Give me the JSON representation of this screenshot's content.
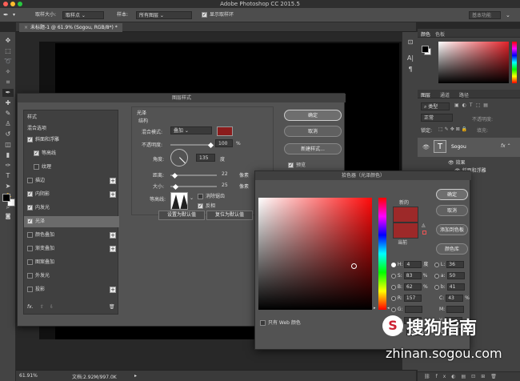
{
  "window": {
    "title": "Adobe Photoshop CC 2015.5"
  },
  "options_bar": {
    "sample_size_label": "取样大小:",
    "sample_size_value": "取样点",
    "sample_label": "样本:",
    "sample_value": "所有图层",
    "show_ring_label": "显示取样环",
    "search_placeholder": "基本功能"
  },
  "document_tab": {
    "label": "未标题-1 @ 61.9% (Sogou, RGB/8*) *"
  },
  "status_bar": {
    "zoom": "61.91%",
    "doc_size": "文档:2.92M/997.0K"
  },
  "right_panel": {
    "color_tabs": [
      "颜色",
      "色板"
    ],
    "layers_tabs": [
      "图层",
      "通道",
      "路径"
    ],
    "kind_label": "类型",
    "blend_mode": "正常",
    "opacity_label": "不透明度:",
    "lock_label": "锁定:",
    "fill_label": "填充:",
    "layer_name": "Sogou",
    "layer_type_glyph": "T",
    "effects_label": "效果",
    "effect_item": "斜面和浮雕"
  },
  "layer_style": {
    "title": "图层样式",
    "style_header": "样式",
    "blend_options": "混合选项",
    "items": [
      {
        "label": "斜面和浮雕",
        "checked": true,
        "plus": false
      },
      {
        "label": "等高线",
        "checked": true,
        "plus": false,
        "sub": true
      },
      {
        "label": "纹理",
        "checked": false,
        "plus": false,
        "sub": true
      },
      {
        "label": "描边",
        "checked": false,
        "plus": true
      },
      {
        "label": "内阴影",
        "checked": true,
        "plus": true
      },
      {
        "label": "内发光",
        "checked": true,
        "plus": false
      },
      {
        "label": "光泽",
        "checked": true,
        "plus": false,
        "selected": true
      },
      {
        "label": "颜色叠加",
        "checked": false,
        "plus": true
      },
      {
        "label": "渐变叠加",
        "checked": false,
        "plus": true
      },
      {
        "label": "图案叠加",
        "checked": false,
        "plus": false
      },
      {
        "label": "外发光",
        "checked": false,
        "plus": false
      },
      {
        "label": "投影",
        "checked": false,
        "plus": true
      }
    ],
    "fx_label": "fx.",
    "section_title": "光泽",
    "structure_label": "结构",
    "blend_mode_label": "混合模式:",
    "blend_mode_value": "叠加",
    "swatch_color": "#8b1c1c",
    "opacity_label": "不透明度:",
    "opacity_value": "100",
    "opacity_unit": "%",
    "angle_label": "角度:",
    "angle_value": "135",
    "angle_unit": "度",
    "distance_label": "距离:",
    "distance_value": "22",
    "distance_unit": "像素",
    "size_label": "大小:",
    "size_value": "25",
    "size_unit": "像素",
    "contour_label": "等高线:",
    "antialias_label": "消除锯齿",
    "invert_label": "反相",
    "make_default": "设置为默认值",
    "reset_default": "复位为默认值",
    "ok": "确定",
    "cancel": "取消",
    "new_style": "新建样式...",
    "preview_label": "预览"
  },
  "color_picker": {
    "title": "拾色器（光泽颜色）",
    "new_label": "新的",
    "current_label": "当前",
    "new_color": "#9d2929",
    "current_color": "#9d2929",
    "ok": "确定",
    "cancel": "取消",
    "add_swatch": "添加到色板",
    "color_library": "颜色库",
    "only_web": "只有 Web 颜色",
    "fields": {
      "H": "4",
      "S": "83",
      "B": "62",
      "R": "157",
      "G": "",
      "Bv": "",
      "L": "36",
      "a": "50",
      "b": "41",
      "C": "43",
      "M": "",
      "Y": "",
      "K": "11"
    },
    "units": {
      "deg": "度",
      "pct": "%"
    },
    "hex": "9d2416"
  },
  "watermark": {
    "brand": "搜狗指南",
    "url": "zhinan.sogou.com"
  },
  "colors": {
    "accent": "#1473e6",
    "swatch": "#9d2929"
  }
}
